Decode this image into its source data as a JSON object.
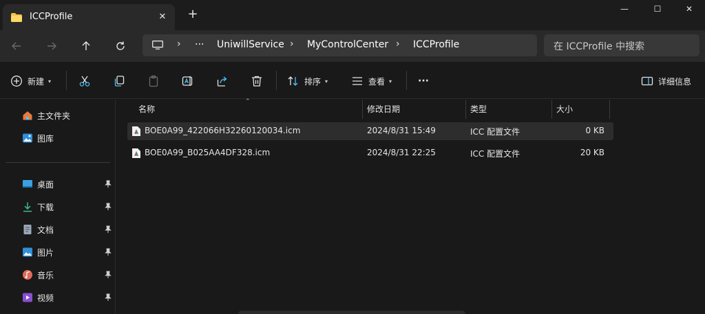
{
  "window": {
    "tab_title": "ICCProfile",
    "minimize_glyph": "—",
    "maximize_glyph": "☐",
    "close_glyph": "✕",
    "new_tab_glyph": "+"
  },
  "address": {
    "overflow": "···",
    "segments": [
      "UniwillService",
      "MyControlCenter",
      "ICCProfile"
    ],
    "separator": "›",
    "search_placeholder": "在 ICCProfile 中搜索"
  },
  "commands": {
    "new_label": "新建",
    "sort_label": "排序",
    "view_label": "查看",
    "more_label": "···",
    "details_label": "详细信息"
  },
  "sidebar": {
    "top": [
      {
        "label": "主文件夹",
        "icon": "home-icon"
      },
      {
        "label": "图库",
        "icon": "gallery-icon"
      }
    ],
    "pinned": [
      {
        "label": "桌面",
        "icon": "desktop-icon"
      },
      {
        "label": "下载",
        "icon": "download-icon"
      },
      {
        "label": "文档",
        "icon": "document-icon"
      },
      {
        "label": "图片",
        "icon": "pictures-icon"
      },
      {
        "label": "音乐",
        "icon": "music-icon"
      },
      {
        "label": "视频",
        "icon": "video-icon"
      }
    ]
  },
  "columns": {
    "name": "名称",
    "modified": "修改日期",
    "type": "类型",
    "size": "大小"
  },
  "files": [
    {
      "name": "BOE0A99_422066H32260120034.icm",
      "modified": "2024/8/31 15:49",
      "type": "ICC 配置文件",
      "size": "0 KB"
    },
    {
      "name": "BOE0A99_B025AA4DF328.icm",
      "modified": "2024/8/31 22:25",
      "type": "ICC 配置文件",
      "size": "20 KB"
    }
  ],
  "colors": {
    "accent": "#4cc2ff",
    "folder_yellow": "#f4c34d",
    "background": "#191919"
  }
}
